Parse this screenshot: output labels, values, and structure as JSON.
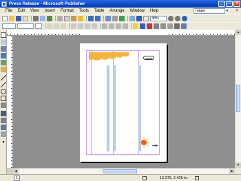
{
  "window": {
    "title": "Press Release - Microsoft Publisher",
    "minimize": "_",
    "maximize": "□",
    "close": "×"
  },
  "menu": {
    "items": [
      "File",
      "Edit",
      "View",
      "Insert",
      "Format",
      "Tools",
      "Table",
      "Arrange",
      "Window",
      "Help"
    ],
    "help_box_value": "rotate",
    "help_arrow": "▾",
    "doc_close": "×"
  },
  "toolbar": {
    "zoom": "38%"
  },
  "scroll": {
    "up": "▲",
    "down": "▼",
    "left": "◀",
    "right": "▶"
  },
  "status": {
    "page_number": "1",
    "position": "13.375, 2.426 in."
  },
  "colors": {
    "titlebar": "#0a47c4",
    "workspace": "#8f8f8f",
    "column_guides": "#c8a3e8",
    "text_columns": "#b9c9ef",
    "clouds": "#f3b23b",
    "sun": "#f06a1e"
  }
}
